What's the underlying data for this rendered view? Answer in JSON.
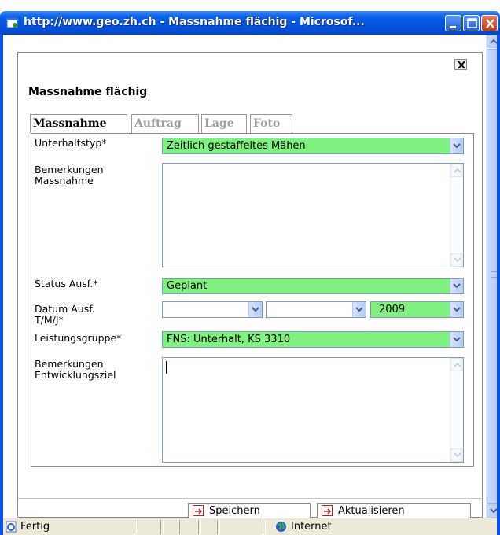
{
  "window": {
    "title": "http://www.geo.zh.ch - Massnahme flächig - Microsof...",
    "colors": {
      "titlebar": "#0450d8",
      "close": "#c4381c",
      "field_required": "#80f080"
    }
  },
  "dialog": {
    "title": "Massnahme flächig",
    "tabs": [
      {
        "label": "Massnahme",
        "active": true
      },
      {
        "label": "Auftrag",
        "active": false
      },
      {
        "label": "Lage",
        "active": false
      },
      {
        "label": "Foto",
        "active": false
      }
    ],
    "fields": {
      "unterhaltstyp": {
        "label": "Unterhaltstyp*",
        "value": "Zeitlich gestaffeltes Mähen"
      },
      "bemerkungen_massnahme": {
        "label_line1": "Bemerkungen",
        "label_line2": "Massnahme",
        "value": ""
      },
      "status": {
        "label": "Status Ausf.*",
        "value": "Geplant"
      },
      "datum": {
        "label_line1": "Datum Ausf.",
        "label_line2": "T/M/J*",
        "day": "",
        "month": "",
        "year": "2009"
      },
      "leistungsgruppe": {
        "label": "Leistungsgruppe*",
        "value": "FNS: Unterhalt, KS 3310"
      },
      "bemerkungen_entwicklungsziel": {
        "label_line1": "Bemerkungen",
        "label_line2": "Entwicklungsziel",
        "value": ""
      }
    },
    "buttons": {
      "save": "Speichern",
      "update": "Aktualisieren"
    }
  },
  "statusbar": {
    "status": "Fertig",
    "zone": "Internet"
  }
}
